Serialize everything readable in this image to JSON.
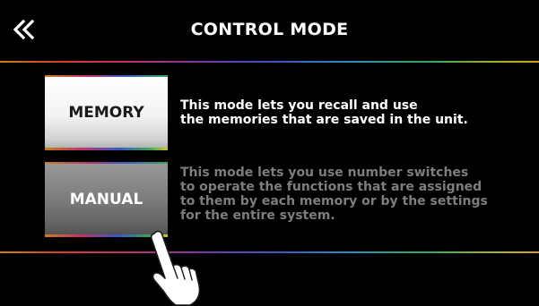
{
  "header": {
    "back_icon": "double-chevron-left-icon",
    "back_glyph": "«",
    "title": "CONTROL MODE"
  },
  "modes": {
    "memory": {
      "label": "MEMORY",
      "description": [
        "This mode lets you recall and use",
        "the memories that are saved in the unit."
      ]
    },
    "manual": {
      "label": "MANUAL",
      "description": [
        "This mode lets you use number switches",
        "to operate the functions that are assigned",
        "to them by each memory or by the settings",
        "for the entire system."
      ]
    }
  },
  "pointer_icon": "pointing-hand-icon",
  "colors": {
    "background": "#000000",
    "memory_button": "#ffffff",
    "manual_button": "#7c7c7c",
    "active_text": "#ffffff",
    "inactive_text": "#7d7d7d"
  }
}
